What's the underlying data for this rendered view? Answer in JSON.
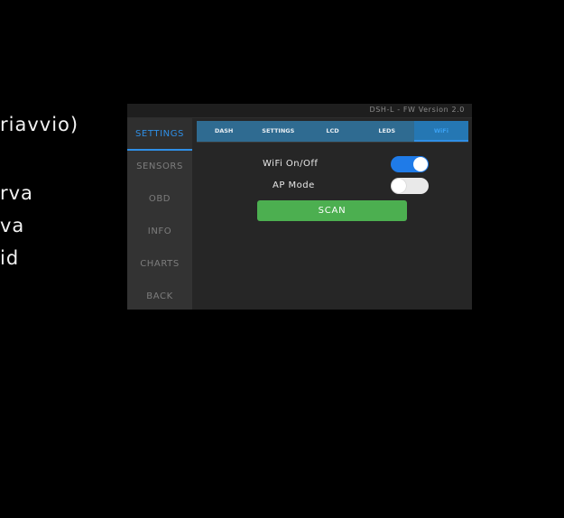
{
  "background_text": [
    "riavvio)",
    "rva",
    "va",
    "id"
  ],
  "device": {
    "firmware": "DSH-L - FW Version 2.0",
    "sidebar": {
      "items": [
        {
          "label": "SETTINGS",
          "active": true
        },
        {
          "label": "SENSORS",
          "active": false
        },
        {
          "label": "OBD",
          "active": false
        },
        {
          "label": "INFO",
          "active": false
        },
        {
          "label": "CHARTS",
          "active": false
        },
        {
          "label": "BACK",
          "active": false
        }
      ]
    },
    "tabs": [
      {
        "label": "DASH",
        "active": false
      },
      {
        "label": "SETTINGS",
        "active": false
      },
      {
        "label": "LCD",
        "active": false
      },
      {
        "label": "LEDS",
        "active": false
      },
      {
        "label": "WiFi",
        "active": true
      }
    ],
    "wifi": {
      "wifi_label": "WiFi On/Off",
      "wifi_on": true,
      "ap_label": "AP Mode",
      "ap_on": false,
      "scan_label": "SCAN"
    },
    "colors": {
      "accent": "#2f8fe6",
      "tab_bar": "#2f6b91",
      "toggle_on": "#1f7be8",
      "scan_button": "#4caf50"
    }
  }
}
